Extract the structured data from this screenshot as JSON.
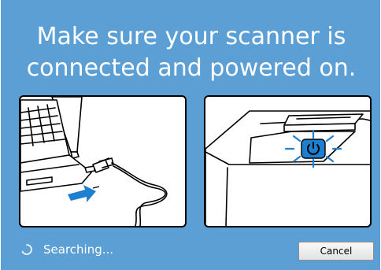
{
  "instruction": {
    "line1": "Make sure your scanner is",
    "line2": "connected and powered on."
  },
  "illustrations": {
    "left": {
      "icon": "laptop-usb-connection-icon"
    },
    "right": {
      "icon": "scanner-power-button-icon"
    }
  },
  "status": {
    "text": "Searching...",
    "icon": "spinner-icon"
  },
  "buttons": {
    "cancel_label": "Cancel"
  },
  "colors": {
    "background": "#5b9fd5",
    "text": "#ffffff",
    "power_button": "#1e7fd0"
  }
}
